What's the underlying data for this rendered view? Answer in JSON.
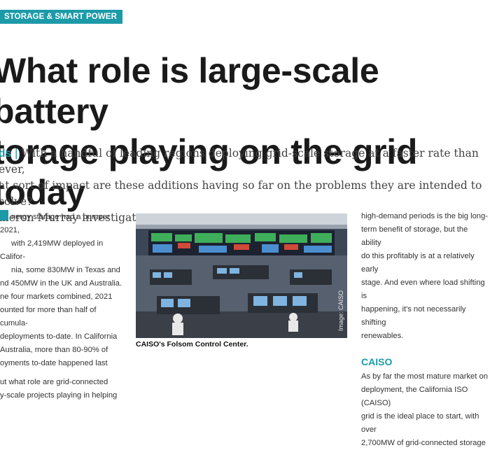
{
  "section_tag": "STORAGE & SMART POWER",
  "headline": {
    "line1": "What role is large-scale battery",
    "line2": "torage playing on the grid today"
  },
  "standfirst": {
    "lead": "ds",
    "text1": "With a handful of leading regions deploying grid-scale storage at a faster rate than ever,",
    "text2": "at sort of impact are these additions having so far on the problems they are intended to solve?",
    "text3": "meron Murray investigates."
  },
  "left_column": {
    "lines": [
      "nergy storage had a bumper 2021,",
      "with 2,419MW deployed in Califor-",
      "nia, some 830MW in Texas and",
      "nd 450MW in the UK and Australia.",
      "ne four markets combined, 2021",
      "ounted for more than half of cumula-",
      "deployments to-date. In California",
      "Australia, more than 80-90% of",
      "oyments to-date happened last",
      "",
      "ut what role are grid-connected",
      "y-scale projects playing in helping"
    ]
  },
  "photo": {
    "credit": "Image: CAISO",
    "caption": "CAISO's Folsom Control Center."
  },
  "right_column": {
    "lines_top": [
      "high-demand periods is the big long-",
      "term benefit of storage, but the ability",
      "do this profitably is at a relatively early",
      "stage. And even where load shifting is",
      "happening, it's not necessarily shifting",
      "renewables."
    ],
    "heading": "CAISO",
    "lines_bottom": [
      "As by far the most mature market on",
      "deployment, the California ISO (CAISO)",
      "grid is the ideal place to start, with over",
      "2,700MW of grid-connected storage"
    ]
  },
  "colors": {
    "accent": "#1d9aa8",
    "headline": "#1a1a1a"
  }
}
